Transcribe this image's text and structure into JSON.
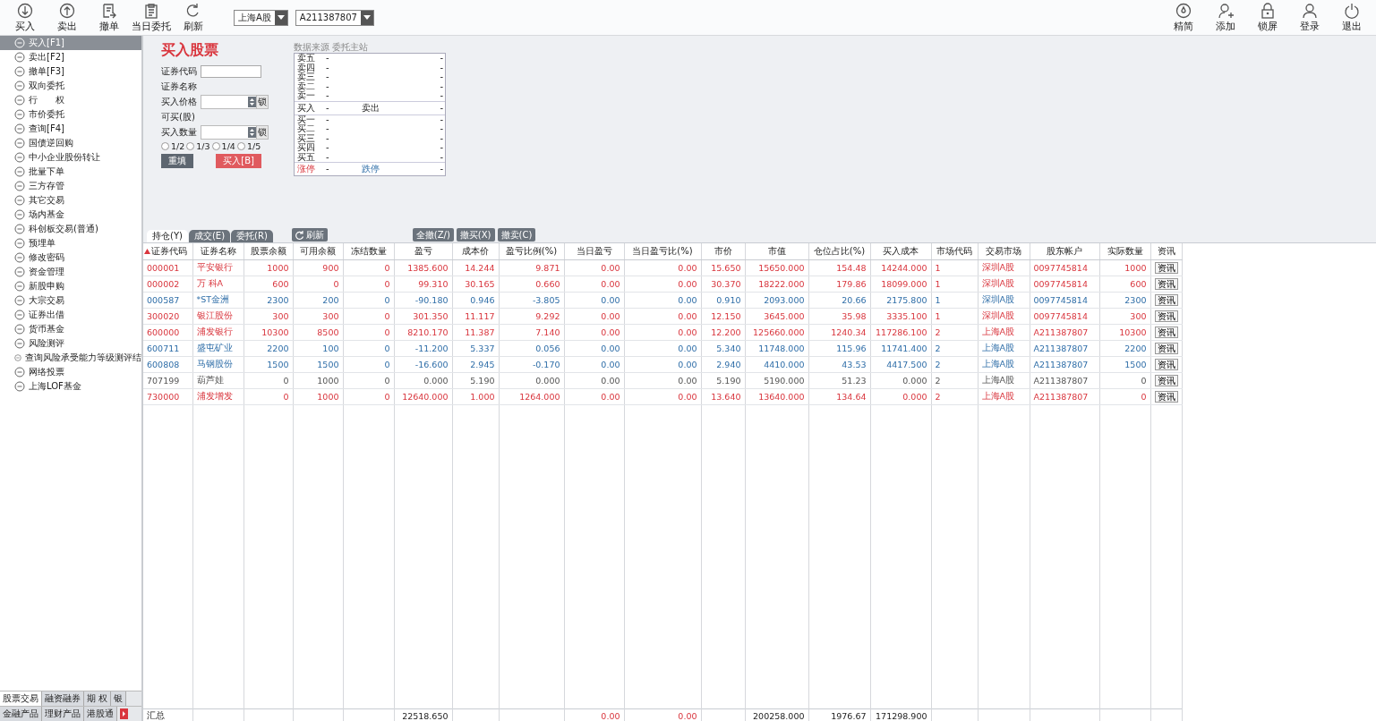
{
  "toolbar": {
    "buttons": [
      {
        "label": "买入"
      },
      {
        "label": "卖出"
      },
      {
        "label": "撤单"
      },
      {
        "label": "当日委托"
      },
      {
        "label": "刷新"
      }
    ],
    "selects": [
      {
        "value": "上海A股"
      },
      {
        "value": "A211387807"
      }
    ],
    "right_buttons": [
      {
        "label": "精简"
      },
      {
        "label": "添加"
      },
      {
        "label": "锁屏"
      },
      {
        "label": "登录"
      },
      {
        "label": "退出"
      }
    ]
  },
  "sidebar": {
    "items": [
      {
        "label": "买入[F1]",
        "selected": true
      },
      {
        "label": "卖出[F2]",
        "selected": false
      },
      {
        "label": "撤单[F3]",
        "selected": false
      },
      {
        "label": "双向委托",
        "selected": false
      },
      {
        "label": "行　　权",
        "selected": false
      },
      {
        "label": "市价委托",
        "selected": false
      },
      {
        "label": "查询[F4]",
        "selected": false
      },
      {
        "label": "国债逆回购",
        "selected": false
      },
      {
        "label": "中小企业股份转让",
        "selected": false
      },
      {
        "label": "批量下单",
        "selected": false
      },
      {
        "label": "三方存管",
        "selected": false
      },
      {
        "label": "其它交易",
        "selected": false
      },
      {
        "label": "场内基金",
        "selected": false
      },
      {
        "label": "科创板交易(普通)",
        "selected": false
      },
      {
        "label": "预埋单",
        "selected": false
      },
      {
        "label": "修改密码",
        "selected": false
      },
      {
        "label": "资金管理",
        "selected": false
      },
      {
        "label": "新股申购",
        "selected": false
      },
      {
        "label": "大宗交易",
        "selected": false
      },
      {
        "label": "证券出借",
        "selected": false
      },
      {
        "label": "货币基金",
        "selected": false
      },
      {
        "label": "风险测评",
        "selected": false
      },
      {
        "label": "查询风险承受能力等级测评结",
        "selected": false
      },
      {
        "label": "网络投票",
        "selected": false
      },
      {
        "label": "上海LOF基金",
        "selected": false
      }
    ],
    "bottom_tabs": [
      {
        "label": "股票交易",
        "selected": true
      },
      {
        "label": "融资融券",
        "selected": false
      },
      {
        "label": "期 权",
        "selected": false
      },
      {
        "label": "银",
        "selected": false
      },
      {
        "label": "金融产品",
        "selected": false
      },
      {
        "label": "理财产品",
        "selected": false
      },
      {
        "label": "港股通",
        "selected": false
      }
    ]
  },
  "order_form": {
    "title": "买入股票",
    "fields": [
      {
        "kind": "input",
        "label": "证券代码"
      },
      {
        "kind": "text",
        "label": "证券名称"
      },
      {
        "kind": "spinner",
        "label": "买入价格",
        "lock": "锁"
      },
      {
        "kind": "text",
        "label": "可买(股)"
      },
      {
        "kind": "spinner",
        "label": "买入数量",
        "lock": "锁"
      }
    ],
    "fractions": [
      {
        "label": "1/2",
        "selected": false
      },
      {
        "label": "1/3",
        "selected": false
      },
      {
        "label": "1/4",
        "selected": false
      },
      {
        "label": "1/5",
        "selected": false
      }
    ],
    "buttons": [
      {
        "kind": "reset",
        "label": "重填"
      },
      {
        "kind": "submit",
        "label": "买入[B]"
      }
    ]
  },
  "order_book": {
    "source": "数据来源 委托主站",
    "sell": [
      {
        "label": "卖五",
        "price": "-",
        "volume": "-"
      },
      {
        "label": "卖四",
        "price": "-",
        "volume": "-"
      },
      {
        "label": "卖三",
        "price": "-",
        "volume": "-"
      },
      {
        "label": "卖二",
        "price": "-",
        "volume": "-"
      },
      {
        "label": "卖一",
        "price": "-",
        "volume": "-"
      }
    ],
    "quote": {
      "buy_label": "买入",
      "buy": "-",
      "sell_label": "卖出",
      "sell": "-"
    },
    "buy": [
      {
        "label": "买一",
        "price": "-",
        "volume": "-"
      },
      {
        "label": "买二",
        "price": "-",
        "volume": "-"
      },
      {
        "label": "买三",
        "price": "-",
        "volume": "-"
      },
      {
        "label": "买四",
        "price": "-",
        "volume": "-"
      },
      {
        "label": "买五",
        "price": "-",
        "volume": "-"
      }
    ],
    "limits": {
      "up_label": "涨停",
      "up": "-",
      "down_label": "跌停",
      "down": "-"
    }
  },
  "tabs": [
    {
      "label": "持仓(Y)",
      "selected": true
    },
    {
      "label": "成交(E)",
      "selected": false
    },
    {
      "label": "委托(R)",
      "selected": false
    }
  ],
  "refresh": "刷新",
  "actions": [
    {
      "label": "全撤(Z/)"
    },
    {
      "label": "撤买(X)"
    },
    {
      "label": "撤卖(C)"
    }
  ],
  "table": {
    "columns": [
      {
        "label": "证券代码",
        "sorted": true
      },
      {
        "label": "证券名称",
        "sorted": false
      },
      {
        "label": "股票余额",
        "sorted": false
      },
      {
        "label": "可用余额",
        "sorted": false
      },
      {
        "label": "冻结数量",
        "sorted": false
      },
      {
        "label": "盈亏",
        "sorted": false
      },
      {
        "label": "成本价",
        "sorted": false
      },
      {
        "label": "盈亏比例(%)",
        "sorted": false
      },
      {
        "label": "当日盈亏",
        "sorted": false
      },
      {
        "label": "当日盈亏比(%)",
        "sorted": false
      },
      {
        "label": "市价",
        "sorted": false
      },
      {
        "label": "市值",
        "sorted": false
      },
      {
        "label": "仓位占比(%)",
        "sorted": false
      },
      {
        "label": "买入成本",
        "sorted": false
      },
      {
        "label": "市场代码",
        "sorted": false
      },
      {
        "label": "交易市场",
        "sorted": false
      },
      {
        "label": "股东帐户",
        "sorted": false
      },
      {
        "label": "实际数量",
        "sorted": false
      },
      {
        "label": "资讯",
        "sorted": false
      }
    ],
    "rows": [
      {
        "color": "#d9363e",
        "cells": [
          "000001",
          "平安银行",
          "1000",
          "900",
          "0",
          "1385.600",
          "14.244",
          "9.871",
          "0.00",
          "0.00",
          "15.650",
          "15650.000",
          "154.48",
          "14244.000",
          "1",
          "深圳A股",
          "0097745814",
          "1000",
          "资讯"
        ]
      },
      {
        "color": "#d9363e",
        "cells": [
          "000002",
          "万 科A",
          "600",
          "0",
          "0",
          "99.310",
          "30.165",
          "0.660",
          "0.00",
          "0.00",
          "30.370",
          "18222.000",
          "179.86",
          "18099.000",
          "1",
          "深圳A股",
          "0097745814",
          "600",
          "资讯"
        ]
      },
      {
        "color": "#2f6ea8",
        "cells": [
          "000587",
          "*ST金洲",
          "2300",
          "200",
          "0",
          "-90.180",
          "0.946",
          "-3.805",
          "0.00",
          "0.00",
          "0.910",
          "2093.000",
          "20.66",
          "2175.800",
          "1",
          "深圳A股",
          "0097745814",
          "2300",
          "资讯"
        ]
      },
      {
        "color": "#d9363e",
        "cells": [
          "300020",
          "银江股份",
          "300",
          "300",
          "0",
          "301.350",
          "11.117",
          "9.292",
          "0.00",
          "0.00",
          "12.150",
          "3645.000",
          "35.98",
          "3335.100",
          "1",
          "深圳A股",
          "0097745814",
          "300",
          "资讯"
        ]
      },
      {
        "color": "#d9363e",
        "cells": [
          "600000",
          "浦发银行",
          "10300",
          "8500",
          "0",
          "8210.170",
          "11.387",
          "7.140",
          "0.00",
          "0.00",
          "12.200",
          "125660.000",
          "1240.34",
          "117286.100",
          "2",
          "上海A股",
          "A211387807",
          "10300",
          "资讯"
        ]
      },
      {
        "color": "#2f6ea8",
        "cells": [
          "600711",
          "盛屯矿业",
          "2200",
          "100",
          "0",
          "-11.200",
          "5.337",
          "0.056",
          "0.00",
          "0.00",
          "5.340",
          "11748.000",
          "115.96",
          "11741.400",
          "2",
          "上海A股",
          "A211387807",
          "2200",
          "资讯"
        ]
      },
      {
        "color": "#2f6ea8",
        "cells": [
          "600808",
          "马钢股份",
          "1500",
          "1500",
          "0",
          "-16.600",
          "2.945",
          "-0.170",
          "0.00",
          "0.00",
          "2.940",
          "4410.000",
          "43.53",
          "4417.500",
          "2",
          "上海A股",
          "A211387807",
          "1500",
          "资讯"
        ]
      },
      {
        "color": "#555555",
        "cells": [
          "707199",
          "葫芦娃",
          "0",
          "1000",
          "0",
          "0.000",
          "5.190",
          "0.000",
          "0.00",
          "0.00",
          "5.190",
          "5190.000",
          "51.23",
          "0.000",
          "2",
          "上海A股",
          "A211387807",
          "0",
          "资讯"
        ]
      },
      {
        "color": "#d9363e",
        "cells": [
          "730000",
          "浦发增发",
          "0",
          "1000",
          "0",
          "12640.000",
          "1.000",
          "1264.000",
          "0.00",
          "0.00",
          "13.640",
          "13640.000",
          "134.64",
          "0.000",
          "2",
          "上海A股",
          "A211387807",
          "0",
          "资讯"
        ]
      }
    ],
    "summary": {
      "label": "汇总",
      "profit": "22518.650",
      "day_profit": "0.00",
      "day_profit_ratio": "0.00",
      "market_value": "200258.000",
      "position_ratio": "1976.67",
      "buy_cost": "171298.900"
    }
  }
}
